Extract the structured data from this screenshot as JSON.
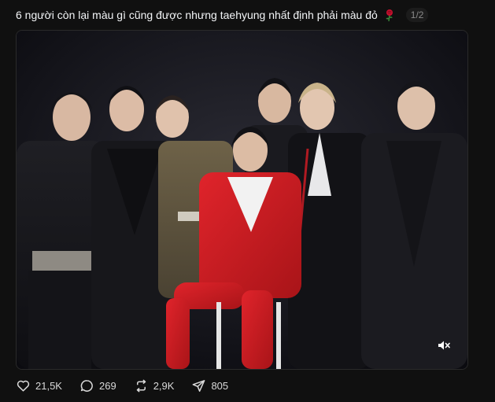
{
  "post": {
    "caption": "6 người còn lại màu gì cũng được nhưng taehyung nhất định phải màu đỏ",
    "caption_emoji_icon": "rose-icon",
    "page_counter": "1/2"
  },
  "media": {
    "mute_icon": "muted-speaker-icon"
  },
  "actions": {
    "likes": "21,5K",
    "replies": "269",
    "reposts": "2,9K",
    "shares": "805"
  }
}
